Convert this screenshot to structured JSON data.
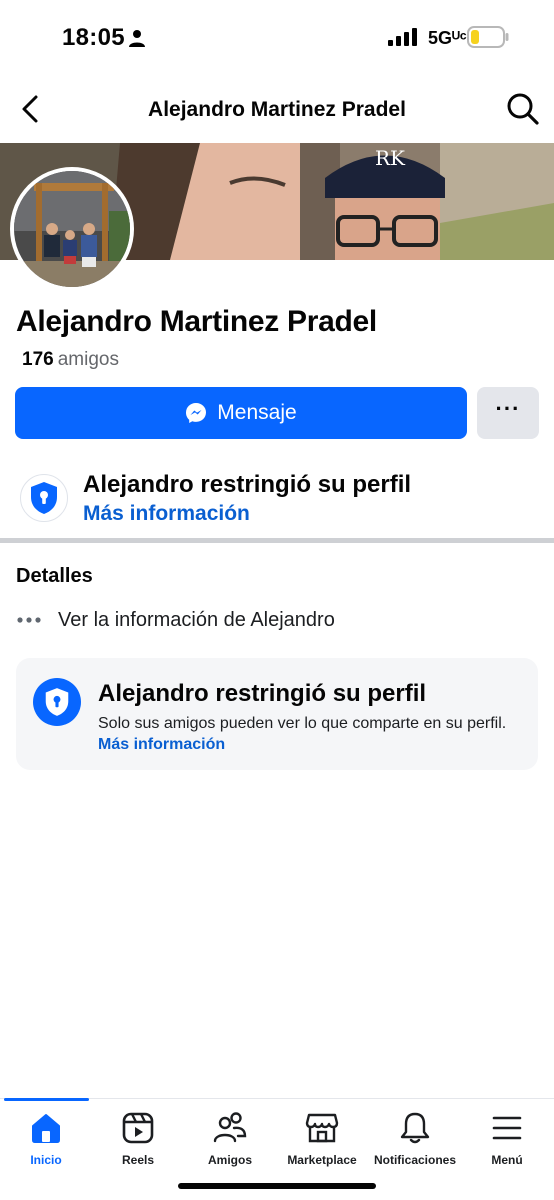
{
  "status_bar": {
    "time": "18:05",
    "network": "5Gᵁᶜ",
    "icons": [
      "person-icon",
      "signal-icon",
      "battery-icon"
    ]
  },
  "header": {
    "title": "Alejandro Martinez Pradel",
    "back_icon": "chevron-left-icon",
    "search_icon": "search-icon"
  },
  "profile": {
    "name": "Alejandro Martinez Pradel",
    "friends_count": "176",
    "friends_label": "amigos",
    "message_button": "Mensaje",
    "more_button": "···"
  },
  "restriction_banner": {
    "title": "Alejandro restringió su perfil",
    "link": "Más información"
  },
  "details": {
    "heading": "Detalles",
    "row_label": "Ver la información de Alejandro"
  },
  "info_card": {
    "title": "Alejandro restringió su perfil",
    "body": "Solo sus amigos pueden ver lo que comparte en su perfil.",
    "link": "Más información"
  },
  "bottom_nav": {
    "items": [
      {
        "label": "Inicio",
        "icon": "home-icon",
        "active": true
      },
      {
        "label": "Reels",
        "icon": "reels-icon",
        "active": false
      },
      {
        "label": "Amigos",
        "icon": "friends-icon",
        "active": false
      },
      {
        "label": "Marketplace",
        "icon": "marketplace-icon",
        "active": false
      },
      {
        "label": "Notificaciones",
        "icon": "bell-icon",
        "active": false
      },
      {
        "label": "Menú",
        "icon": "menu-icon",
        "active": false
      }
    ]
  },
  "colors": {
    "accent": "#0866ff",
    "link": "#0a5fd1",
    "secondary_button": "#e4e6eb",
    "card_background": "#f5f6f8",
    "divider": "#ced0d4"
  }
}
